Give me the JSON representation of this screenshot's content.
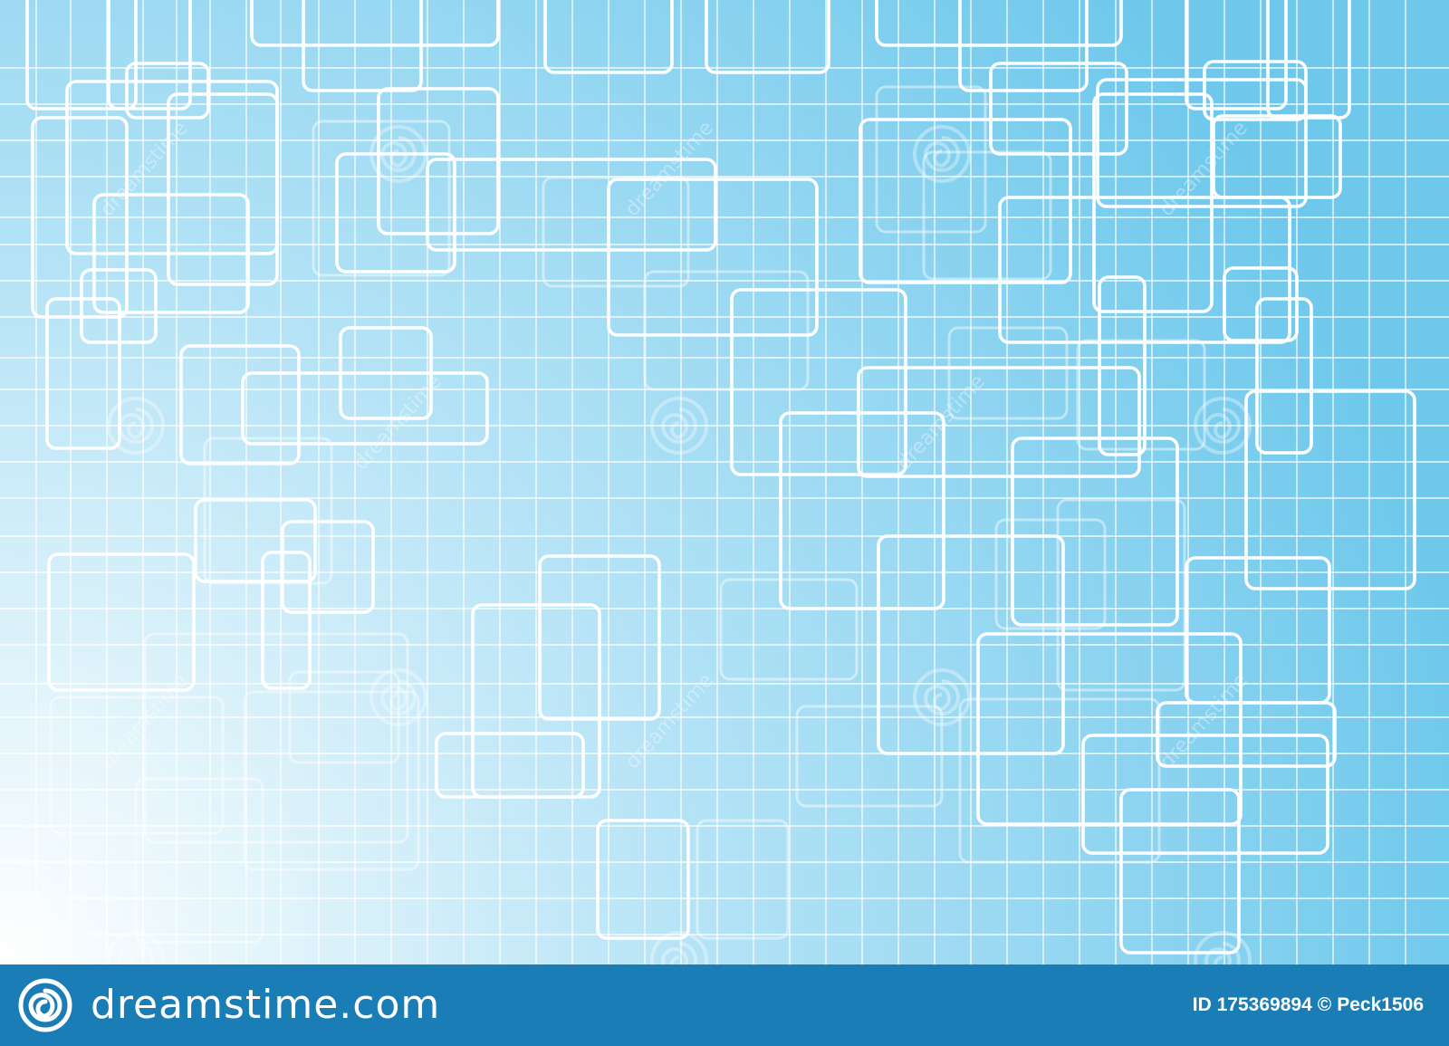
{
  "colors": {
    "background_light": "#ffffff",
    "background_mid": "#b7e4f6",
    "background_deep": "#6ec8ec",
    "line": "#ffffff",
    "footer_bar": "#1a7db5",
    "footer_text": "#ffffff"
  },
  "icons": {
    "footer_logo": "spiral-logo-icon",
    "watermark": "spiral-watermark-icon"
  },
  "watermark_text": "dreamstime",
  "footer": {
    "brand": "dreamstime.com",
    "id_label": "ID 175369894",
    "copyright_symbol": "©",
    "author": "Peck1506"
  }
}
